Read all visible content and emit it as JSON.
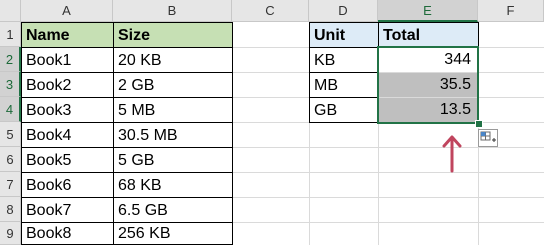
{
  "columns": [
    "A",
    "B",
    "C",
    "D",
    "E",
    "F"
  ],
  "rows": [
    "1",
    "2",
    "3",
    "4",
    "5",
    "6",
    "7",
    "8",
    "9"
  ],
  "tableA": {
    "headers": [
      "Name",
      "Size"
    ],
    "rows": [
      [
        "Book1",
        "20 KB"
      ],
      [
        "Book2",
        "2 GB"
      ],
      [
        "Book3",
        "5 MB"
      ],
      [
        "Book4",
        "30.5 MB"
      ],
      [
        "Book5",
        "5 GB"
      ],
      [
        "Book6",
        "68 KB"
      ],
      [
        "Book7",
        "6.5 GB"
      ],
      [
        "Book8",
        "256 KB"
      ]
    ]
  },
  "tableD": {
    "headers": [
      "Unit",
      "Total"
    ],
    "rows": [
      [
        "KB",
        "344"
      ],
      [
        "MB",
        "35.5"
      ],
      [
        "GB",
        "13.5"
      ]
    ]
  },
  "colors": {
    "selection": "#217346",
    "arrow": "#c0455e",
    "header_fill_left": "#c6e0b4",
    "header_fill_right": "#ddebf7"
  },
  "icons": {
    "quick_analysis": "quick-analysis-icon",
    "arrow": "up-arrow-icon"
  }
}
